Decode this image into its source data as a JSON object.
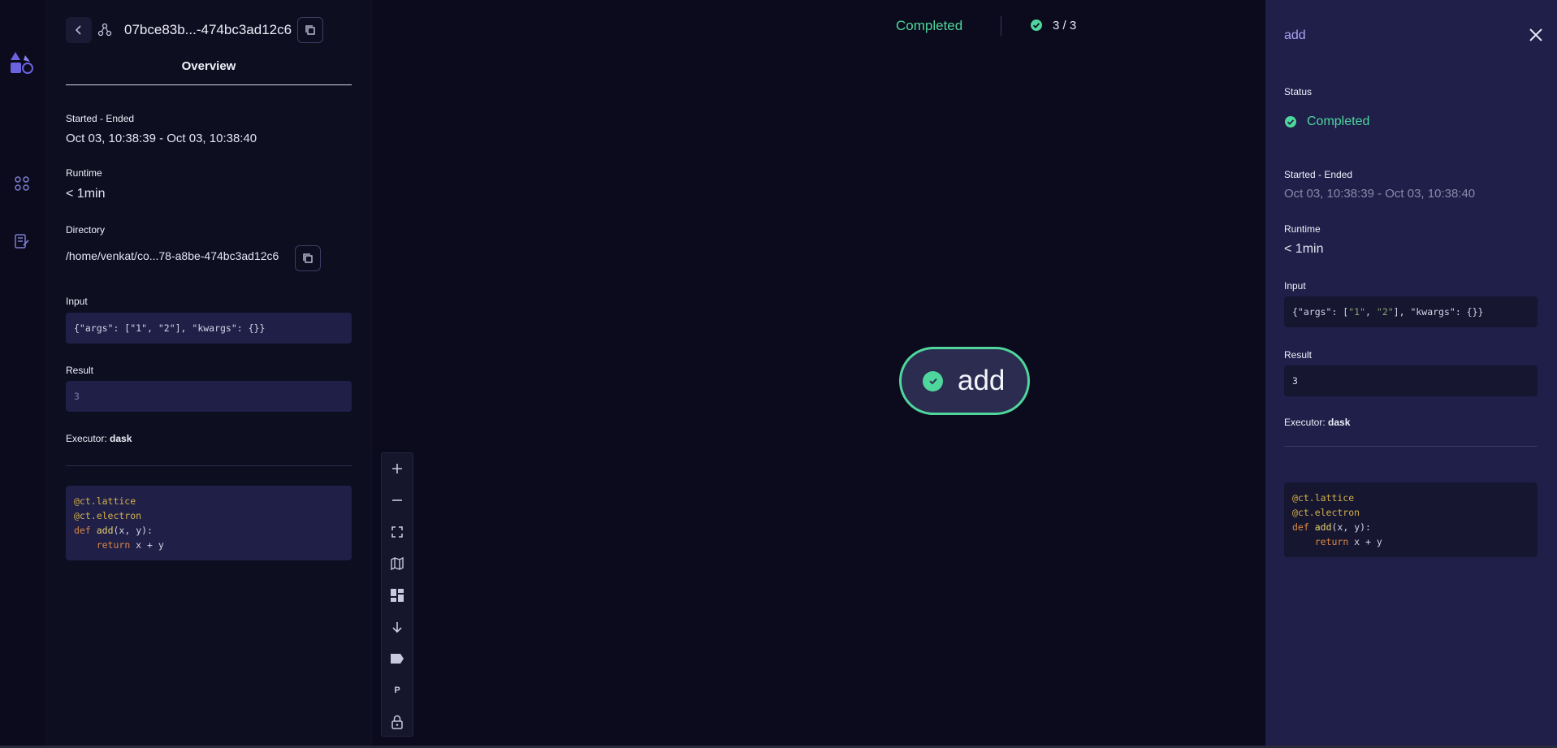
{
  "header": {
    "dispatch_id": "07bce83b...-474bc3ad12c6"
  },
  "tabs": {
    "overview": "Overview"
  },
  "overview": {
    "started_ended_label": "Started - Ended",
    "started_ended_value": "Oct 03, 10:38:39 - Oct 03, 10:38:40",
    "runtime_label": "Runtime",
    "runtime_value": "< 1min",
    "directory_label": "Directory",
    "directory_value": "/home/venkat/co...78-a8be-474bc3ad12c6",
    "input_label": "Input",
    "input_value": "{\"args\": [\"1\", \"2\"], \"kwargs\": {}}",
    "result_label": "Result",
    "result_value": "3",
    "executor_label": "Executor:",
    "executor_value": "dask",
    "code_lines": [
      "@ct.lattice",
      "@ct.electron",
      "def add(x, y):",
      "    return x + y"
    ]
  },
  "graph": {
    "status": "Completed",
    "progress": "3 / 3",
    "node_label": "add",
    "toolbar": [
      "zoom-in",
      "zoom-out",
      "fit-view",
      "minimap",
      "layout",
      "direction",
      "labels",
      "parameters",
      "lock"
    ],
    "parameter_button_label": "P"
  },
  "drawer": {
    "title": "add",
    "status_label": "Status",
    "status_value": "Completed",
    "started_ended_label": "Started - Ended",
    "started_ended_value": "Oct 03, 10:38:39 - Oct 03, 10:38:40",
    "runtime_label": "Runtime",
    "runtime_value": "< 1min",
    "input_label": "Input",
    "result_label": "Result",
    "result_value": "3",
    "executor_label": "Executor:",
    "executor_value": "dask"
  },
  "colors": {
    "success": "#4fd69c",
    "accent": "#a9a2f2",
    "drawer_bg": "#1f1f49",
    "canvas_bg": "#0b0b1d"
  }
}
